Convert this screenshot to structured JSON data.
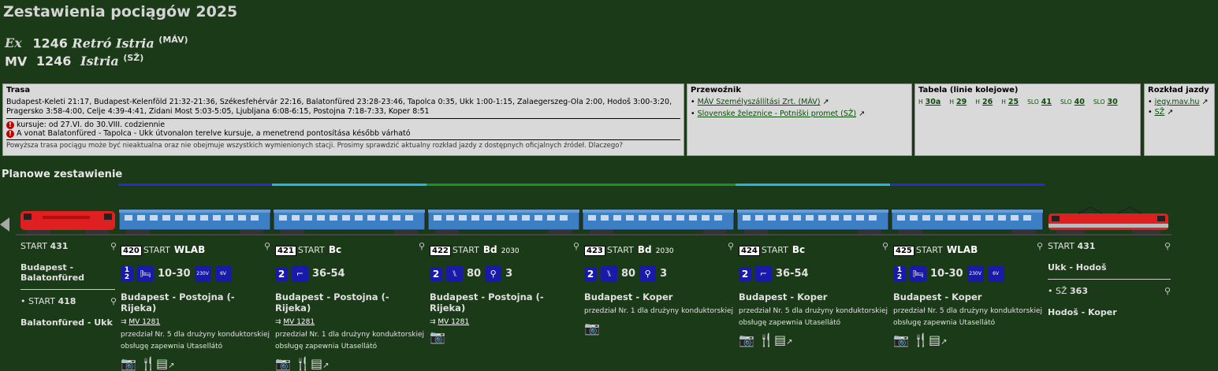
{
  "page_title": "Zestawienia pociągów 2025",
  "train1": {
    "icon": "Ex",
    "number": "1246",
    "name": "Retró Istria",
    "operator": "(MÁV)"
  },
  "train2": {
    "prefix": "MV",
    "number": "1246",
    "name": "Istria",
    "operator": "(SŽ)"
  },
  "trasa": {
    "heading": "Trasa",
    "route": "Budapest-Keleti 21:17, Budapest-Kelenföld 21:32-21:36, Székesfehérvár 22:16, Balatonfüred 23:28-23:46, Tapolca 0:35, Ukk 1:00-1:15, Zalaegerszeg-Ola 2:00, Hodoš 3:00-3:20, Pragersko 3:58-4:00, Celje 4:39-4:41, Zidani Most 5:03-5:05, Ljubljana 6:08-6:15, Postojna 7:18-7:33, Koper 8:51",
    "notice1": "kursuje: od 27.VI. do 30.VIII. codziennie",
    "notice2": "A vonat Balatonfüred - Tapolca - Ukk útvonalon terelve kursuje, a menetrend pontosítása később várható",
    "disclaimer": "Powyższa trasa pociągu może być nieaktualna oraz nie obejmuje wszystkich wymienionych stacji. Prosimy sprawdzić aktualny rozkład jazdy z dostępnych oficjalnych źródeł. Dlaczego?"
  },
  "przewoznik": {
    "heading": "Przewoźnik",
    "items": [
      "MÁV Személyszállítási Zrt. (MÁV)",
      "Slovenske železnice - Potniški promet (SŽ)"
    ]
  },
  "tabela": {
    "heading": "Tabela (linie kolejowe)",
    "items": [
      {
        "pre": "H",
        "num": "30a"
      },
      {
        "pre": "H",
        "num": "29"
      },
      {
        "pre": "H",
        "num": "26"
      },
      {
        "pre": "H",
        "num": "25"
      },
      {
        "pre": "SLO",
        "num": "41"
      },
      {
        "pre": "SLO",
        "num": "40"
      },
      {
        "pre": "SLO",
        "num": "30"
      }
    ]
  },
  "rozklad": {
    "heading": "Rozkład jazdy",
    "items": [
      "jegy.mav.hu",
      "SŽ"
    ]
  },
  "section_title": "Planowe zestawienie",
  "colors": {
    "blue_bar": "#2a2ad0",
    "cyan_bar": "#29b3e0",
    "green_bar": "#1e8f2a",
    "loco_red": "#e02020",
    "car_blue": "#3d7fc4"
  },
  "loco_left": {
    "start_label": "START",
    "start_num": "431",
    "route": "Budapest - Balatonfüred",
    "start2_label": "START",
    "start2_num": "418",
    "route2": "Balatonfüred - Ukk"
  },
  "cars": [
    {
      "num": "420",
      "start": "START",
      "type": "WLAB",
      "extra": "",
      "cls": "1 2",
      "seats": "10-30",
      "ico1": "bed-icon",
      "ico2": "socket-230v-icon",
      "ico3": "usb-6v-icon",
      "socket": "230V",
      "usb": "6V",
      "route": "Budapest - Postojna (- Rijeka)",
      "mv": "MV 1281",
      "note": "przedział Nr. 5 dla drużyny konduktorskiej obsługę zapewnia Utasellátó",
      "icons": "📷 🍴📰 ↗"
    },
    {
      "num": "421",
      "start": "START",
      "type": "Bc",
      "extra": "",
      "cls": "2",
      "seats": "36-54",
      "ico1": "couchette-icon",
      "route": "Budapest - Postojna (- Rijeka)",
      "mv": "MV 1281",
      "note": "przedział Nr. 1 dla drużyny konduktorskiej obsługę zapewnia Utasellátó",
      "icons": "📷 🍴📰 ↗"
    },
    {
      "num": "422",
      "start": "START",
      "type": "Bd",
      "extra": "2030",
      "cls": "2",
      "seats": "80",
      "bikes": "3",
      "ico1": "seat-icon",
      "route": "Budapest - Postojna (- Rijeka)",
      "mv": "MV 1281",
      "note": "",
      "icons": "📷"
    },
    {
      "num": "423",
      "start": "START",
      "type": "Bd",
      "extra": "2030",
      "cls": "2",
      "seats": "80",
      "bikes": "3",
      "ico1": "seat-icon",
      "route": "Budapest - Koper",
      "mv": "",
      "note": "przedział Nr. 1 dla drużyny konduktorskiej",
      "icons": "📷"
    },
    {
      "num": "424",
      "start": "START",
      "type": "Bc",
      "extra": "",
      "cls": "2",
      "seats": "36-54",
      "ico1": "couchette-icon",
      "route": "Budapest - Koper",
      "mv": "",
      "note": "przedział Nr. 5 dla drużyny konduktorskiej obsługę zapewnia Utasellátó",
      "icons": "📷 🍴📰 ↗"
    },
    {
      "num": "425",
      "start": "START",
      "type": "WLAB",
      "extra": "",
      "cls": "1 2",
      "seats": "10-30",
      "ico1": "bed-icon",
      "socket": "230V",
      "usb": "6V",
      "route": "Budapest - Koper",
      "mv": "",
      "note": "przedział Nr. 5 dla drużyny konduktorskiej obsługę zapewnia Utasellátó",
      "icons": "📷 🍴📰 ↗"
    }
  ],
  "loco_right": {
    "start_label": "START",
    "start_num": "431",
    "route": "Ukk - Hodoš",
    "start2_label": "SŽ",
    "start2_num": "363",
    "route2": "Hodoš - Koper"
  }
}
